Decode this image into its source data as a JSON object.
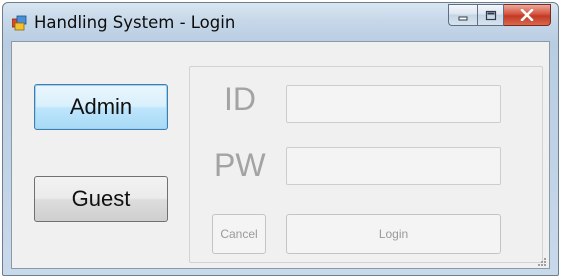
{
  "window": {
    "title": "Handling System - Login",
    "icon": "app-windows-icon",
    "controls": {
      "minimize": "minimize-icon",
      "maximize": "maximize-icon",
      "close": "close-icon"
    }
  },
  "side_buttons": {
    "admin": "Admin",
    "guest": "Guest"
  },
  "form": {
    "id_label": "ID",
    "pw_label": "PW",
    "id_value": "",
    "pw_value": "",
    "cancel_label": "Cancel",
    "login_label": "Login",
    "enabled": false
  },
  "colors": {
    "focus_border": "#3c7fb1",
    "disabled_text": "#a3a3a3",
    "close_button": "#c23a23"
  }
}
